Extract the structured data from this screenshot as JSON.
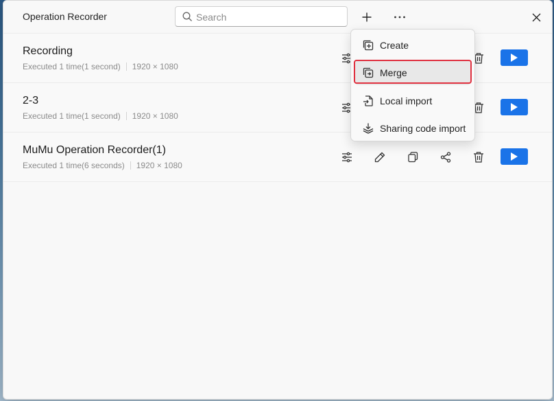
{
  "window": {
    "title": "Operation Recorder",
    "search": {
      "placeholder": "Search",
      "value": ""
    },
    "toolbar": {
      "add_icon": "plus-icon",
      "more_icon": "more-horizontal-icon",
      "close_icon": "close-icon"
    }
  },
  "recordings": [
    {
      "name": "Recording",
      "executed": "Executed 1 time(1 second)",
      "resolution": "1920 × 1080"
    },
    {
      "name": "2-3",
      "executed": "Executed 1 time(1 second)",
      "resolution": "1920 × 1080"
    },
    {
      "name": "MuMu Operation Recorder(1)",
      "executed": "Executed 1 time(6 seconds)",
      "resolution": "1920 × 1080"
    }
  ],
  "row_actions": [
    "settings-sliders-icon",
    "edit-pencil-icon",
    "copy-icon",
    "share-icon",
    "delete-trash-icon",
    "play-icon"
  ],
  "menu": {
    "items": [
      {
        "label": "Create",
        "icon": "create-icon"
      },
      {
        "label": "Merge",
        "icon": "merge-icon",
        "highlighted": true
      },
      {
        "label": "Local import",
        "icon": "file-import-icon"
      },
      {
        "label": "Sharing code import",
        "icon": "download-layers-icon"
      }
    ]
  },
  "colors": {
    "accent": "#1a73e8",
    "highlight": "#e0303f",
    "background": "#f8f8f8"
  }
}
